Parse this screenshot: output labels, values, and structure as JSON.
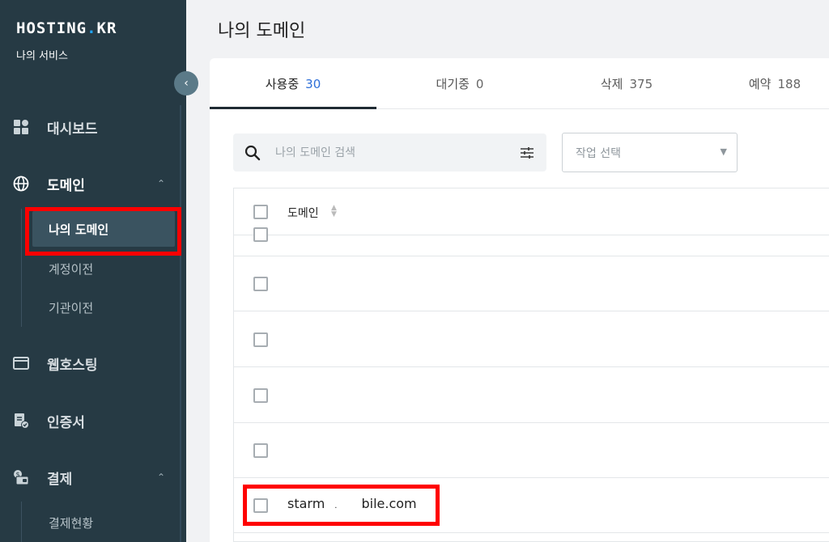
{
  "sidebar": {
    "logo_main": "HOSTING",
    "logo_dot": ".",
    "logo_tail": "KR",
    "service_label": "나의 서비스",
    "collapse_icon": "chevron-left-icon",
    "menu": [
      {
        "label": "대시보드",
        "icon": "dashboard-icon"
      },
      {
        "label": "도메인",
        "icon": "globe-icon",
        "expanded": true,
        "chevron": "^"
      },
      {
        "label": "웹호스팅",
        "icon": "window-icon"
      },
      {
        "label": "인증서",
        "icon": "certificate-icon"
      },
      {
        "label": "결제",
        "icon": "payment-icon",
        "expanded": true,
        "chevron": "^"
      }
    ],
    "domain_sub": [
      {
        "label": "나의 도메인",
        "active": true
      },
      {
        "label": "계정이전"
      },
      {
        "label": "기관이전"
      }
    ],
    "payment_sub": [
      {
        "label": "결제현황"
      }
    ]
  },
  "header": {
    "title": "나의 도메인"
  },
  "tabs": [
    {
      "label": "사용중",
      "count": "30",
      "active": true
    },
    {
      "label": "대기중",
      "count": "0"
    },
    {
      "label": "삭제",
      "count": "375"
    },
    {
      "label": "예약",
      "count": "188"
    }
  ],
  "search": {
    "placeholder": "나의 도메인 검색",
    "value": ""
  },
  "action_select": {
    "selected": "작업 선택",
    "arrow": "▼"
  },
  "table": {
    "header": "도메인",
    "rows": [
      {
        "domain": ""
      },
      {
        "domain": ""
      },
      {
        "domain": ""
      },
      {
        "domain": ""
      },
      {
        "domain": ""
      },
      {
        "domain_prefix": "starm",
        "domain_mid": ".",
        "domain_suffix": "bile.com"
      }
    ]
  },
  "colors": {
    "sidebar_bg": "#263a44",
    "accent_blue": "#2e6fd8",
    "highlight_red": "#ff0000"
  }
}
